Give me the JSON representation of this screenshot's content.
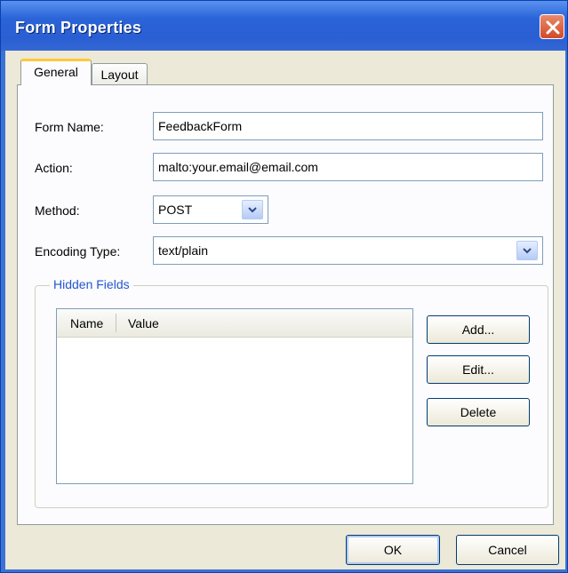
{
  "dialog": {
    "title": "Form Properties"
  },
  "tabs": [
    {
      "label": "General",
      "selected": true
    },
    {
      "label": "Layout",
      "selected": false
    }
  ],
  "fields": {
    "form_name": {
      "label": "Form Name:",
      "value": "FeedbackForm"
    },
    "action": {
      "label": "Action:",
      "value": "malto:your.email@email.com"
    },
    "method": {
      "label": "Method:",
      "value": "POST"
    },
    "encoding_type": {
      "label": "Encoding Type:",
      "value": "text/plain"
    }
  },
  "hidden_fields": {
    "title": "Hidden Fields",
    "columns": [
      "Name",
      "Value"
    ],
    "rows": []
  },
  "buttons": {
    "add": "Add...",
    "edit": "Edit...",
    "delete": "Delete",
    "ok": "OK",
    "cancel": "Cancel"
  },
  "colors": {
    "titlebar": "#2a64d8",
    "dialog_bg": "#ece9d8",
    "tab_highlight": "#ffc83c",
    "group_title": "#2456d0"
  },
  "icons": {
    "close": "close-icon",
    "dropdown": "chevron-down-icon"
  }
}
